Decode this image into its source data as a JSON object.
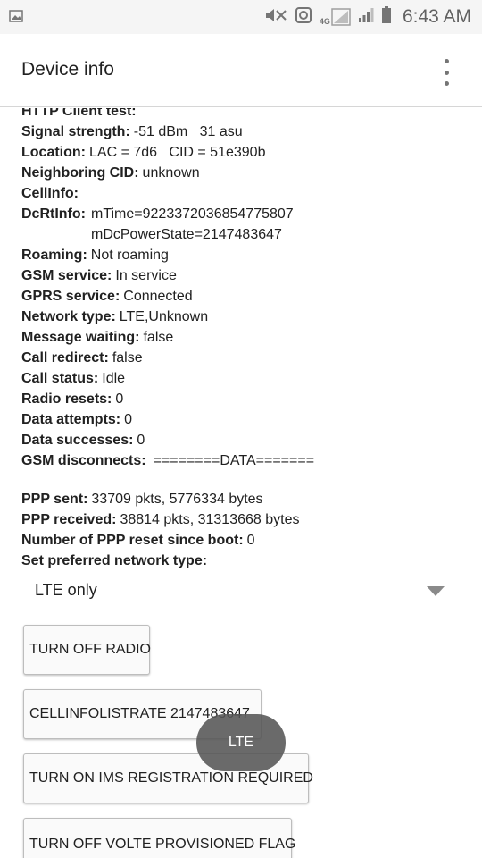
{
  "status_bar": {
    "time": "6:43 AM",
    "network_badge": "4G",
    "icons": [
      "image-icon",
      "mute-icon",
      "data-saver-icon",
      "signal-icon",
      "signal-icon",
      "battery-icon"
    ]
  },
  "app_bar": {
    "title": "Device info",
    "menu_icon": "overflow-menu-icon"
  },
  "info": {
    "http_client_test": {
      "label": "HTTP Client test:",
      "value": ""
    },
    "signal_strength": {
      "label": "Signal strength:",
      "value": "-51 dBm   31 asu"
    },
    "location": {
      "label": "Location:",
      "value": "LAC = 7d6   CID = 51e390b"
    },
    "neighboring_cid": {
      "label": "Neighboring CID:",
      "value": "unknown"
    },
    "cell_info": {
      "label": "CellInfo:",
      "value": ""
    },
    "dcrt_info": {
      "label": "DcRtInfo:",
      "value_line1": "mTime=9223372036854775807",
      "value_line2": "mDcPowerState=2147483647"
    },
    "roaming": {
      "label": "Roaming:",
      "value": "Not roaming"
    },
    "gsm_service": {
      "label": "GSM service:",
      "value": "In service"
    },
    "gprs_service": {
      "label": "GPRS service:",
      "value": "Connected"
    },
    "network_type": {
      "label": "Network type:",
      "value": "LTE,Unknown"
    },
    "message_waiting": {
      "label": "Message waiting:",
      "value": "false"
    },
    "call_redirect": {
      "label": "Call redirect:",
      "value": "false"
    },
    "call_status": {
      "label": "Call status:",
      "value": "Idle"
    },
    "radio_resets": {
      "label": "Radio resets:",
      "value": "0"
    },
    "data_attempts": {
      "label": "Data attempts:",
      "value": "0"
    },
    "data_successes": {
      "label": "Data successes:",
      "value": "0"
    },
    "gsm_disconnects": {
      "label": "GSM disconnects:",
      "value": "========DATA======="
    },
    "ppp_sent": {
      "label": "PPP sent:",
      "value": "33709 pkts, 5776334 bytes"
    },
    "ppp_received": {
      "label": "PPP received:",
      "value": "38814 pkts, 31313668 bytes"
    },
    "ppp_reset": {
      "label": "Number of PPP reset since boot:",
      "value": "0"
    },
    "preferred_network": {
      "label": "Set preferred network type:"
    }
  },
  "spinner": {
    "value": "LTE only"
  },
  "buttons": {
    "radio": "TURN OFF RADIO",
    "cellinfo": "CELLINFOLISTRATE 2147483647",
    "ims": "TURN ON IMS REGISTRATION REQUIRED",
    "volte": "TURN OFF VOLTE PROVISIONED FLAG"
  },
  "toast": {
    "text": "LTE"
  }
}
